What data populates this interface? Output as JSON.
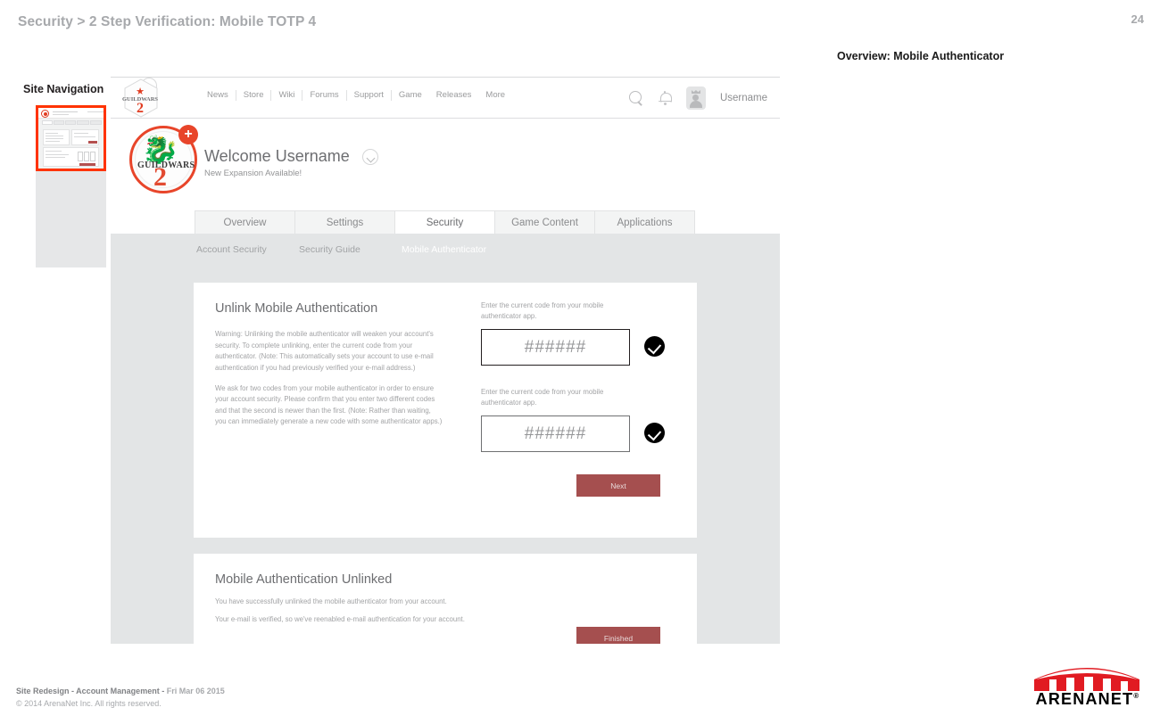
{
  "slide": {
    "title": "Security > 2 Step Verification: Mobile TOTP 4",
    "number": "24",
    "section_label": "Overview: Mobile Authenticator"
  },
  "sitenav": {
    "title": "Site Navigation"
  },
  "mock": {
    "topnav": {
      "logo_name": "guild-wars-2-hex-logo",
      "links": [
        "News",
        "Store",
        "Wiki",
        "Forums",
        "Support",
        "Game",
        "Releases",
        "More"
      ],
      "search_icon": "search-icon",
      "bell_icon": "notification-bell-icon",
      "avatar_icon": "user-avatar-icon",
      "username": "Username"
    },
    "welcome": {
      "logo_name": "guild-wars-2-circle-logo",
      "badge": "+",
      "title": "Welcome Username",
      "subtitle": "New Expansion Available!",
      "caret_icon": "chevron-down-icon"
    },
    "tabs": [
      {
        "label": "Overview",
        "active": false
      },
      {
        "label": "Settings",
        "active": false
      },
      {
        "label": "Security",
        "active": true
      },
      {
        "label": "Game Content",
        "active": false
      },
      {
        "label": "Applications",
        "active": false
      }
    ],
    "subnav": [
      {
        "label": "Account Security",
        "active": false
      },
      {
        "label": "Security Guide",
        "active": false
      },
      {
        "label": "Mobile Authenticator",
        "active": true
      }
    ],
    "card_unlink": {
      "title": "Unlink Mobile Authentication",
      "paragraph_1": "Warning: Unlinking the mobile authenticator will weaken your account's security. To complete unlinking, enter the current code from your authenticator. (Note: This automatically sets your account to use e-mail authentication if you had previously verified your e-mail address.)",
      "paragraph_2": "We ask for two codes from your mobile authenticator in order to ensure your account security. Please confirm that you enter two different codes and that the second is newer than the first. (Note: Rather than waiting, you can immediately generate a new code with some authenticator apps.)",
      "field_1": {
        "label": "Enter the current code from your mobile authenticator app.",
        "value": "######",
        "status_icon": "check-circle-icon"
      },
      "field_2": {
        "label": "Enter the current code from your mobile authenticator app.",
        "value": "######",
        "status_icon": "check-circle-icon"
      },
      "next_button": "Next"
    },
    "card_unlinked": {
      "title": "Mobile Authentication Unlinked",
      "line_1": "You have successfully unlinked the mobile authenticator from your account.",
      "line_2": "Your e-mail is verified, so we've reenabled e-mail authentication for your account.",
      "finished_button": "Finished"
    }
  },
  "footer": {
    "project": "Site Redesign - Account Management - ",
    "date": "Fri Mar 06 2015",
    "copyright": "© 2014 ArenaNet Inc. All rights reserved.",
    "logo_text": "ARENANET",
    "logo_mark": "arenanet-arch-logo"
  },
  "colors": {
    "accent_red": "#e8452a",
    "button_red": "#a54f4f",
    "highlight_orange": "#ff3300",
    "content_gray": "#e3e5e6"
  }
}
